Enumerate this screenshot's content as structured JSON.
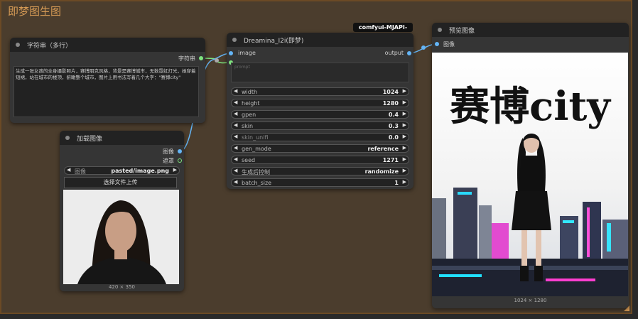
{
  "group": {
    "title": "即梦图生图"
  },
  "string_node": {
    "title": "字符串（多行）",
    "output_label": "字符串",
    "text": "生成一张女孩的全身摄影照片，赛博朋克风格，背景是赛博城市，无数霓虹灯光，她穿着短裙，站在城市的楼顶，俯瞰整个城市，图片上用书法写着几个大字：\"赛博city\""
  },
  "load_image_node": {
    "title": "加载图像",
    "outputs": [
      "图像",
      "遮罩"
    ],
    "image_widget": {
      "label": "图像",
      "value": "pasted/image.png"
    },
    "upload_button": "选择文件上传",
    "image_size": "420 × 350"
  },
  "dreamina_node": {
    "title": "Dreamina_I2i(即梦)",
    "badge": "comfyui-MJAPI-party",
    "input_label": "image",
    "output_label": "output",
    "prompt_placeholder": "prompt",
    "widgets": [
      {
        "label": "width",
        "value": "1024"
      },
      {
        "label": "height",
        "value": "1280"
      },
      {
        "label": "gpen",
        "value": "0.4"
      },
      {
        "label": "skin",
        "value": "0.3"
      },
      {
        "label": "skin_unifi",
        "value": "0.0"
      },
      {
        "label": "gen_mode",
        "value": "reference"
      },
      {
        "label": "seed",
        "value": "1271"
      },
      {
        "label": "生成后控制",
        "value": "randomize"
      },
      {
        "label": "batch_size",
        "value": "1"
      }
    ]
  },
  "preview_node": {
    "title": "预览图像",
    "input_label": "图像",
    "image_text": "赛博city",
    "image_size": "1024 × 1280"
  },
  "colors": {
    "group_bg": "#4b3d2d",
    "group_title": "#d59a55",
    "string_socket": "#7ee37e",
    "image_socket": "#64b5f6"
  }
}
